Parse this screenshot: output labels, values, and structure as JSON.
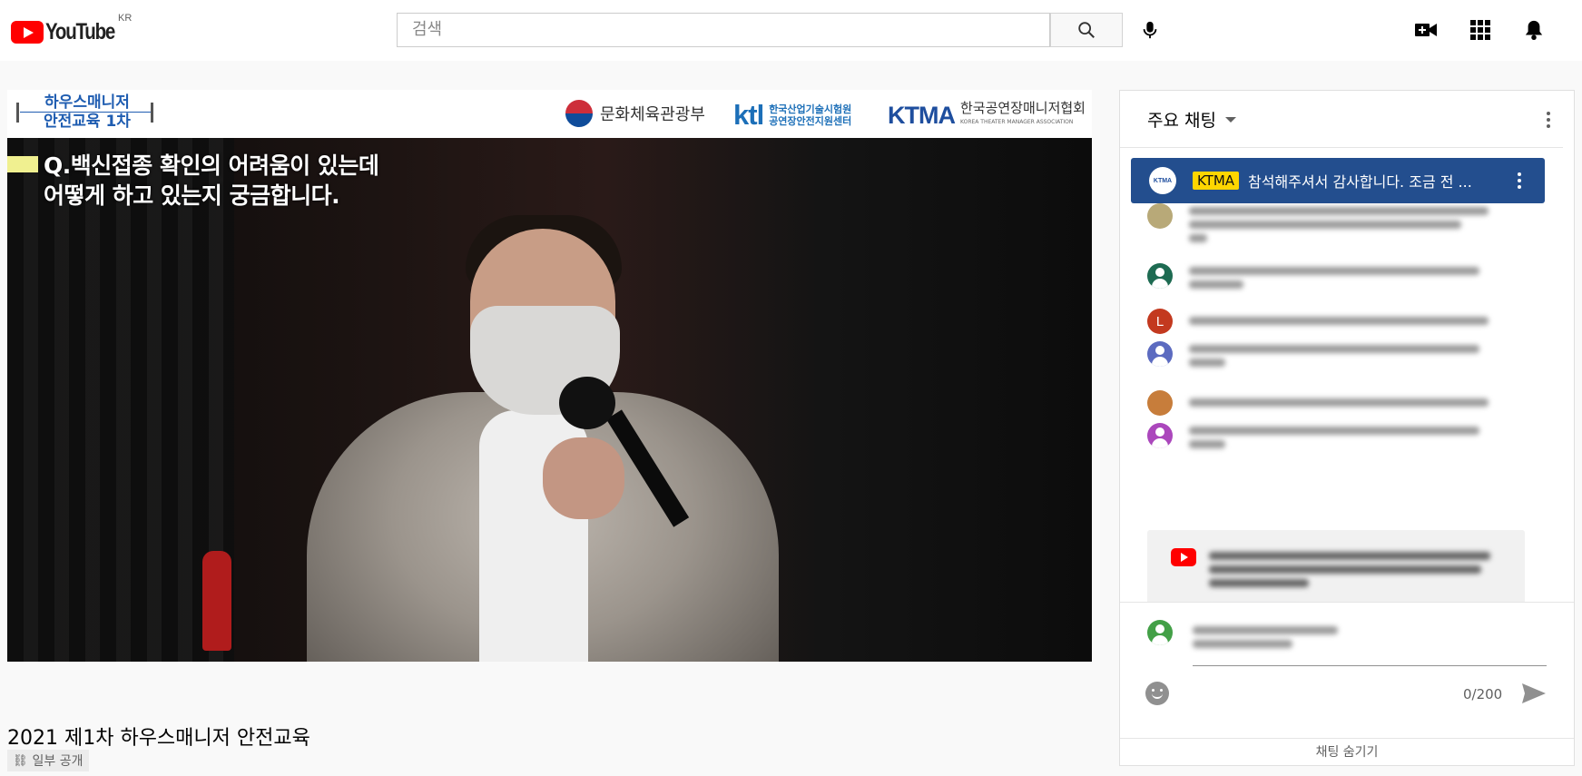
{
  "header": {
    "logo_text": "YouTube",
    "region": "KR",
    "search_placeholder": "검색",
    "icons": [
      "search-icon",
      "microphone-icon",
      "create-video-icon",
      "apps-grid-icon",
      "notifications-bell-icon"
    ]
  },
  "video": {
    "banner_title": "하우스매니저\n안전교육 1차",
    "sponsor_mcst": "문화체육관광부",
    "sponsor_ktl_logo": "ktl",
    "sponsor_ktl_sub": "한국산업기술시험원\n공연장안전지원센터",
    "sponsor_ktma_logo": "KTMA",
    "sponsor_ktma_sub": "한국공연장매니저협회",
    "sponsor_ktma_en": "KOREA THEATER MANAGER ASSOCIATION",
    "question_line1": "Q.백신접종 확인의 어려움이 있는데",
    "question_line2": "어떻게 하고 있는지 궁금합니다.",
    "title": "2021 제1차 하우스매니저 안전교육",
    "privacy": "일부 공개"
  },
  "chat": {
    "title": "주요 채팅",
    "pinned": {
      "author_badge": "KTMA",
      "avatar_text": "KTMA",
      "message": "참석해주셔서 감사합니다. 조금 전 ..."
    },
    "avatar_colors": [
      "#1e6b52",
      "#c3391f",
      "#5c6bc0",
      "#c77d3b",
      "#ab47bc",
      "#43a047"
    ],
    "avatar_letter": "L",
    "counter": "0/200",
    "hide_label": "채팅 숨기기"
  },
  "colors": {
    "youtube_red": "#ff0000",
    "pinned_bg": "#234e8e",
    "badge_yellow": "#ffd600"
  }
}
